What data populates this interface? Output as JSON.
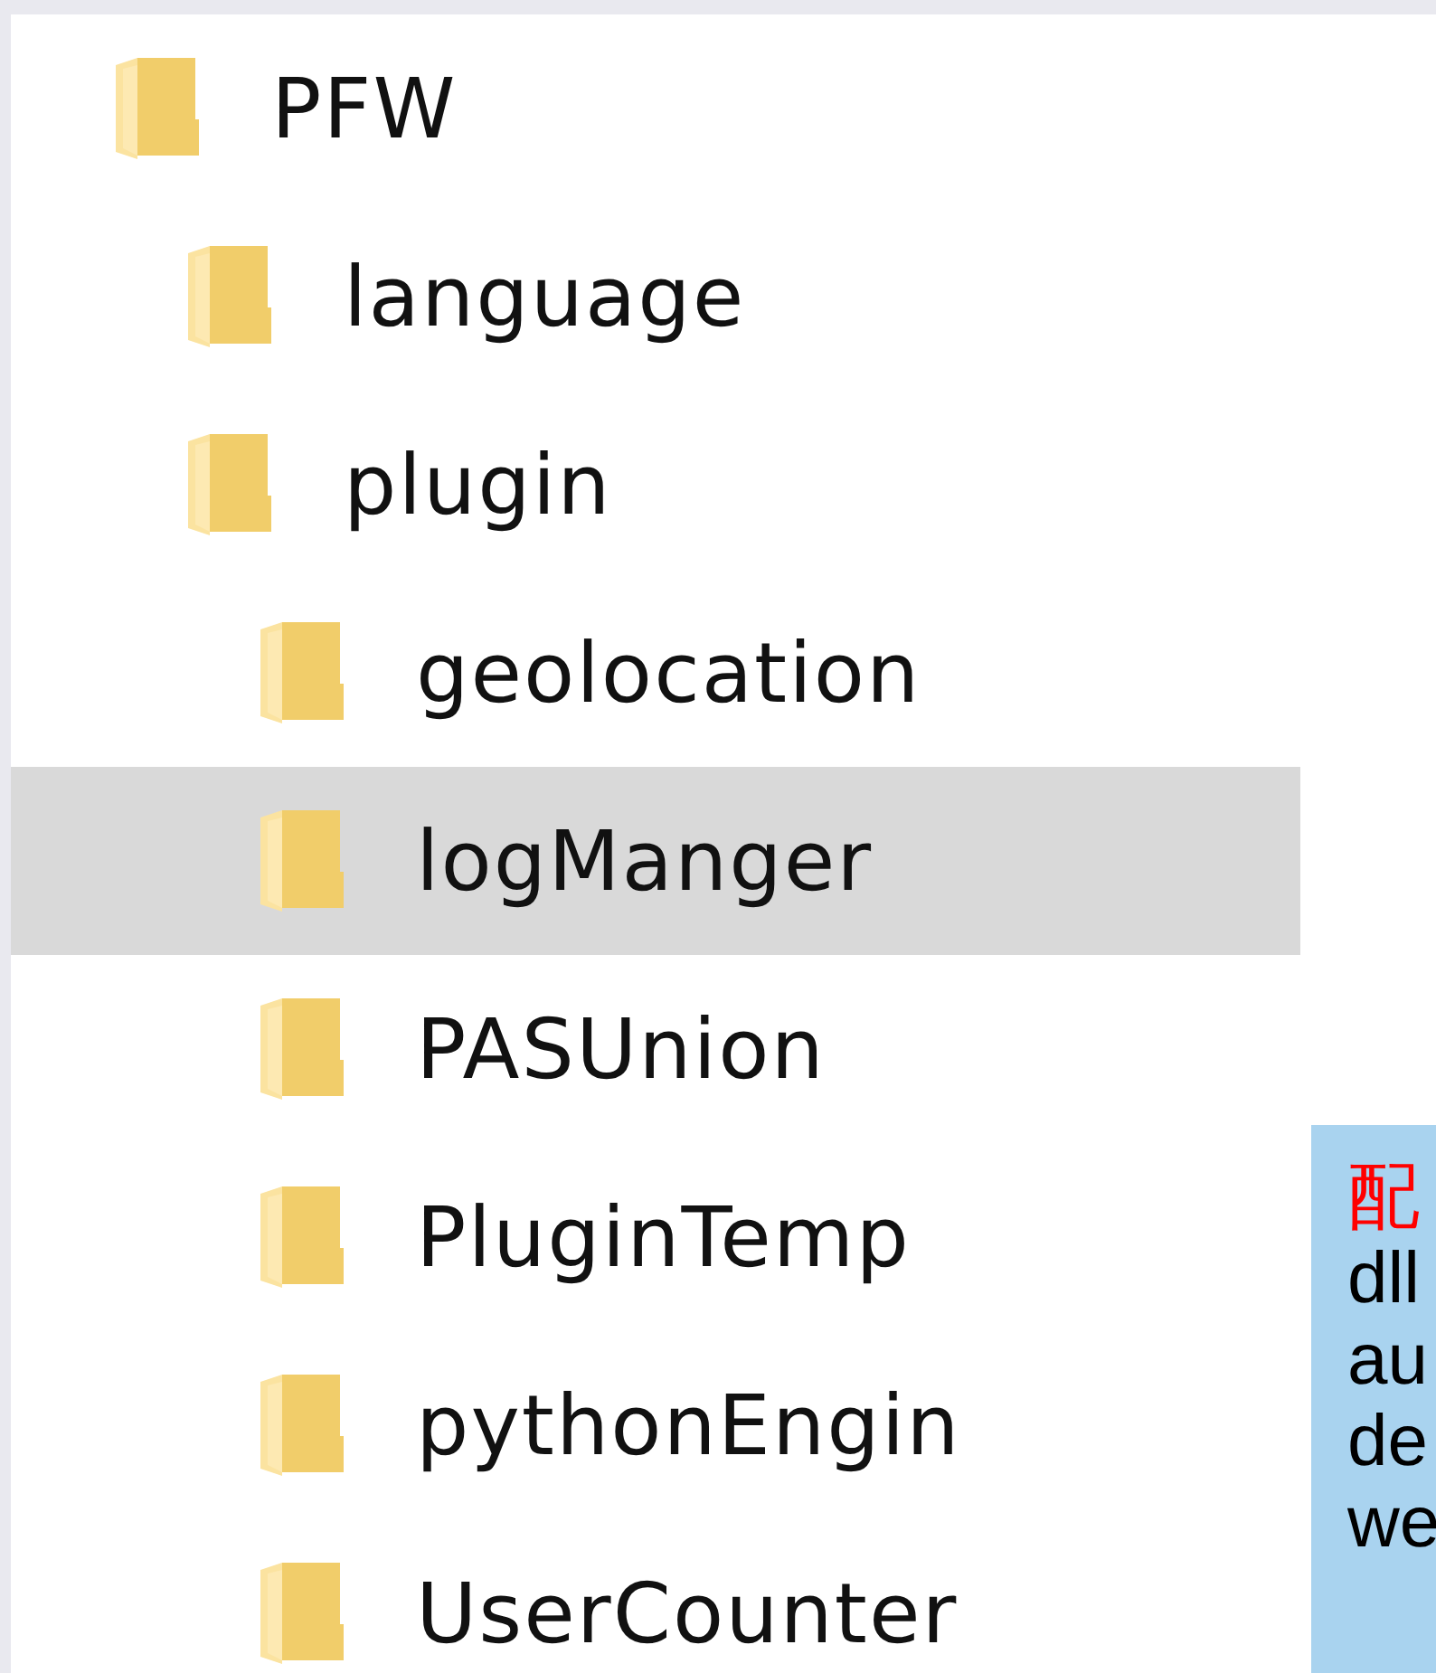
{
  "tree": [
    {
      "label": "PFW",
      "selected": false,
      "children": [
        {
          "label": "language",
          "selected": false
        },
        {
          "label": "plugin",
          "selected": false,
          "children": [
            {
              "label": "geolocation",
              "selected": false
            },
            {
              "label": "logManger",
              "selected": true
            },
            {
              "label": "PASUnion",
              "selected": false
            },
            {
              "label": "PluginTemp",
              "selected": false
            },
            {
              "label": "pythonEngin",
              "selected": false
            },
            {
              "label": "UserCounter",
              "selected": false
            }
          ]
        }
      ]
    }
  ],
  "callout": {
    "lines": [
      {
        "text": "配",
        "kind": "highlight"
      },
      {
        "text": "dll",
        "kind": "plain"
      },
      {
        "text": "au",
        "kind": "plain"
      },
      {
        "text": "de",
        "kind": "plain"
      },
      {
        "text": "we",
        "kind": "plain"
      }
    ]
  }
}
